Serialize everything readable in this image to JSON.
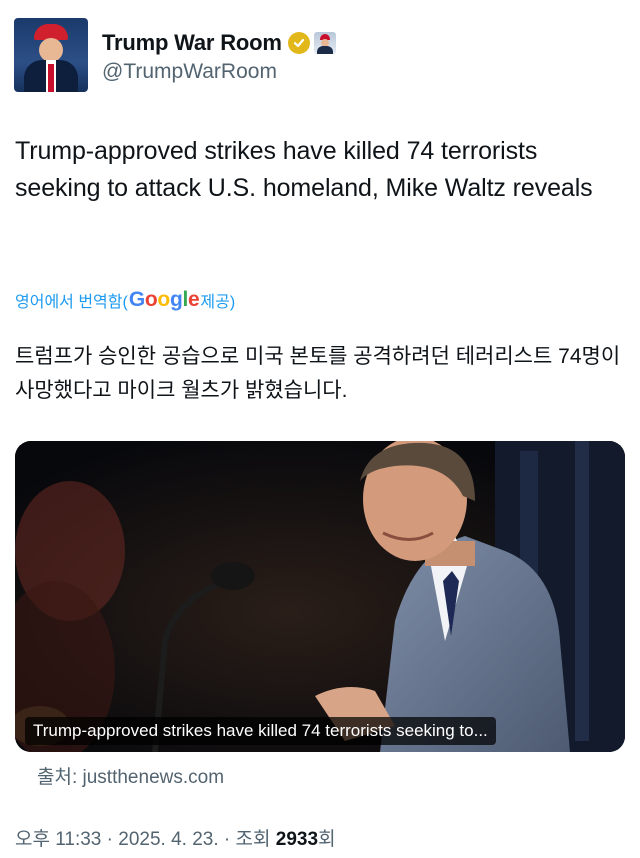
{
  "account": {
    "display_name": "Trump War Room",
    "handle": "@TrumpWarRoom",
    "avatar_text": "TRUMP"
  },
  "tweet": {
    "text": "Trump-approved strikes have killed 74 terrorists seeking to attack U.S. homeland, Mike Waltz reveals",
    "translation_label_prefix": "영어에서 번역함(",
    "translation_label_brand": "Google",
    "translation_label_suffix": " 제공)",
    "translated_text": "트럼프가 승인한 공습으로 미국 본토를 공격하려던 테러리스트 74명이 사망했다고 마이크 월츠가 밝혔습니다."
  },
  "link_card": {
    "caption": "Trump-approved strikes have killed 74 terrorists seeking to...",
    "source": "출처: justthenews.com"
  },
  "meta": {
    "time": "오후 11:33",
    "separator": " · ",
    "date": "2025. 4. 23.",
    "views_prefix": "조회 ",
    "views_count": "2933",
    "views_suffix": "회"
  },
  "colors": {
    "link_blue": "#1d9bf0",
    "verified_gold": "#e2b719",
    "secondary_text": "#536471",
    "google_blue": "#4285f4",
    "google_red": "#ea4335",
    "google_yellow": "#fbbc05",
    "google_green": "#34a853"
  },
  "icons": [
    "verified-badge-icon",
    "affiliate-badge-icon"
  ]
}
